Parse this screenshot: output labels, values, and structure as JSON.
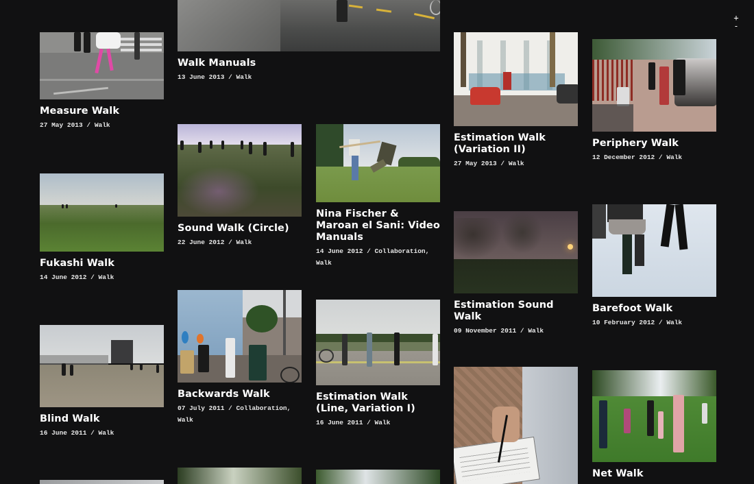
{
  "zoom": {
    "plus": "+",
    "minus": "-"
  },
  "cards": [
    {
      "id": "measure",
      "title": "Measure Walk",
      "meta": "27 May 2013 / Walk"
    },
    {
      "id": "manuals",
      "title": "Walk Manuals",
      "meta": "13 June 2013 / Walk"
    },
    {
      "id": "estimation2",
      "title": "Estimation Walk (Variation II)",
      "meta": "27 May 2013 / Walk"
    },
    {
      "id": "periphery",
      "title": "Periphery Walk",
      "meta": "12 December 2012 / Walk"
    },
    {
      "id": "fukashi",
      "title": "Fukashi Walk",
      "meta": "14 June 2012 / Walk"
    },
    {
      "id": "soundcircle",
      "title": "Sound Walk (Circle)",
      "meta": "22 June 2012 / Walk"
    },
    {
      "id": "nina",
      "title": "Nina Fischer & Maroan el Sani: Video Manuals",
      "meta": "14 June 2012 / Collaboration, Walk"
    },
    {
      "id": "estsound",
      "title": "Estimation Sound Walk",
      "meta": "09 November 2011 / Walk"
    },
    {
      "id": "barefoot",
      "title": "Barefoot Walk",
      "meta": "10 February 2012 / Walk"
    },
    {
      "id": "blind",
      "title": "Blind Walk",
      "meta": "16 June 2011 / Walk"
    },
    {
      "id": "backwards",
      "title": "Backwards Walk",
      "meta": "07 July 2011 / Collaboration, Walk"
    },
    {
      "id": "estline",
      "title": "Estimation Walk (Line, Variation I)",
      "meta": "16 June 2011 / Walk"
    },
    {
      "id": "net",
      "title": "Net Walk",
      "meta": ""
    }
  ]
}
